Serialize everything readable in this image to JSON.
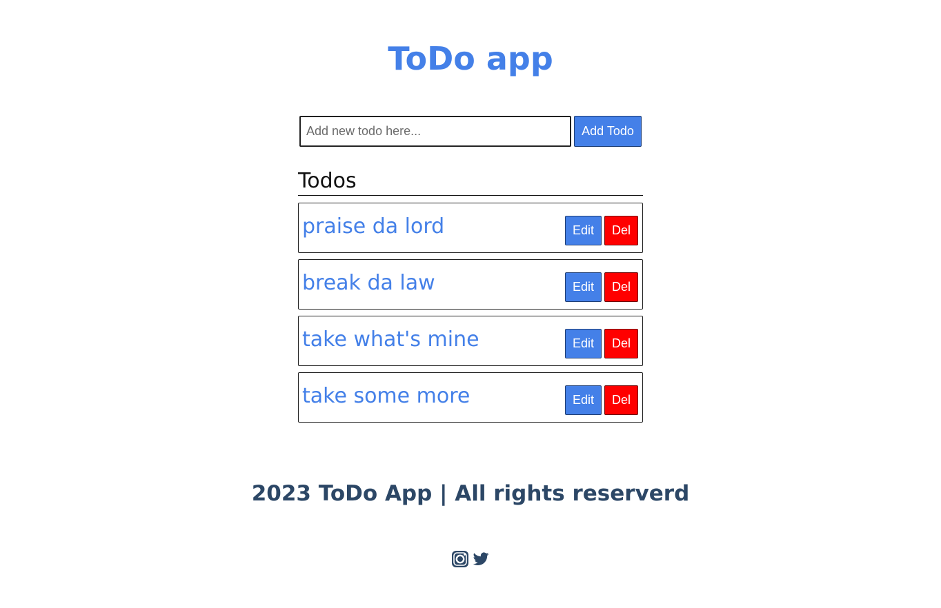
{
  "header": {
    "title": "ToDo app"
  },
  "add_form": {
    "placeholder": "Add new todo here...",
    "value": "",
    "button_label": "Add Todo"
  },
  "todos_section": {
    "heading": "Todos",
    "items": [
      {
        "text": "praise da lord",
        "edit_label": "Edit",
        "delete_label": "Del"
      },
      {
        "text": "break da law",
        "edit_label": "Edit",
        "delete_label": "Del"
      },
      {
        "text": "take what's mine",
        "edit_label": "Edit",
        "delete_label": "Del"
      },
      {
        "text": "take some more",
        "edit_label": "Edit",
        "delete_label": "Del"
      }
    ]
  },
  "footer": {
    "text": "2023 ToDo App | All rights reserverd",
    "social_icons": [
      "instagram-icon",
      "twitter-icon"
    ]
  },
  "colors": {
    "accent": "#4480e8",
    "danger": "#ff0000",
    "footer": "#2c4766"
  }
}
